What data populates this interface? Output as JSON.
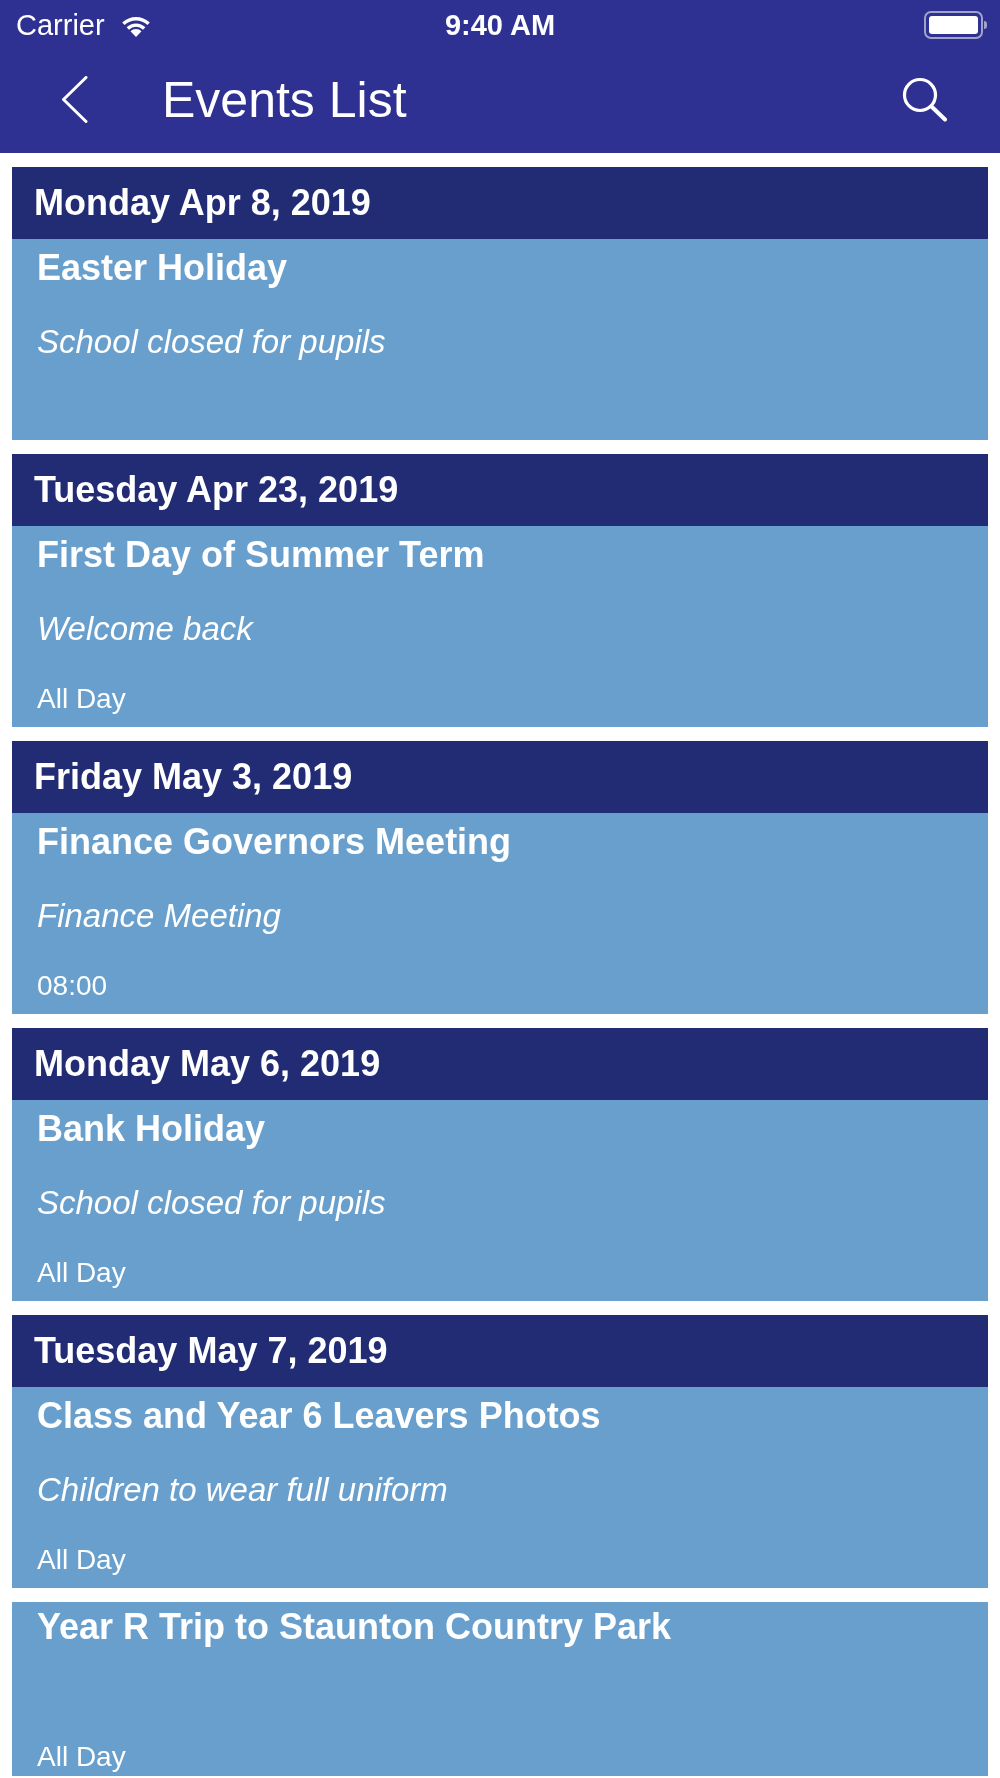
{
  "status_bar": {
    "carrier": "Carrier",
    "time": "9:40 AM"
  },
  "nav_bar": {
    "title": "Events List"
  },
  "events": [
    {
      "date": "Monday Apr 8, 2019",
      "title": "Easter Holiday",
      "description": "School closed for pupils"
    },
    {
      "date": "Tuesday Apr 23, 2019",
      "title": "First Day of Summer Term",
      "description": "Welcome back",
      "time": "All Day"
    },
    {
      "date": "Friday May 3, 2019",
      "title": "Finance Governors Meeting",
      "description": "Finance Meeting",
      "time": "08:00"
    },
    {
      "date": "Monday May 6, 2019",
      "title": "Bank Holiday",
      "description": "School closed for pupils",
      "time": "All Day"
    },
    {
      "date": "Tuesday May 7, 2019",
      "title": "Class and Year 6 Leavers Photos",
      "description": "Children to wear full uniform",
      "time": "All Day"
    },
    {
      "title": "Year R Trip to Staunton Country Park",
      "time": "All Day"
    }
  ]
}
